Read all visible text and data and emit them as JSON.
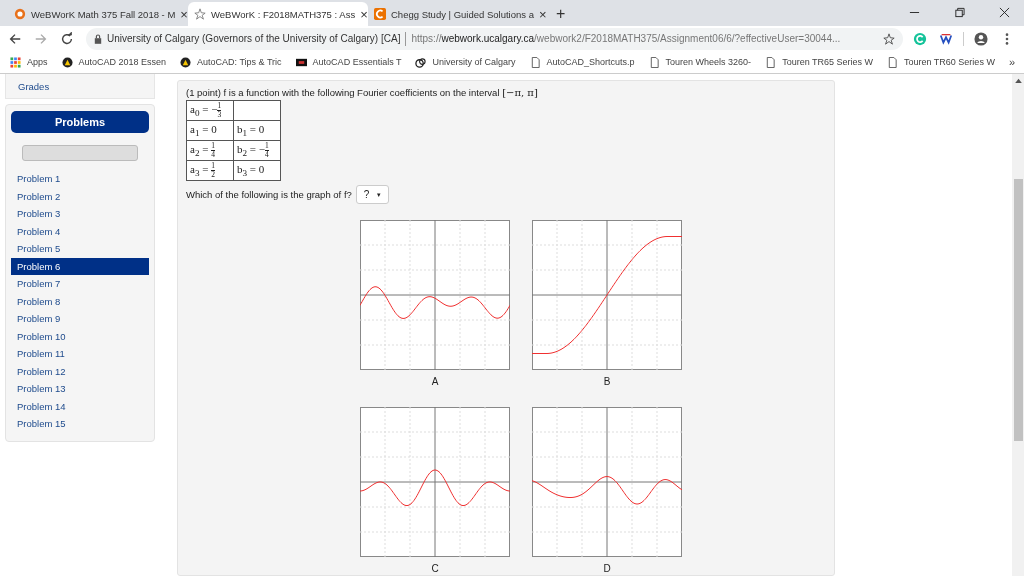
{
  "tabs": [
    {
      "title": "WeBWorK Math 375 Fall 2018 - M",
      "kind": "badge",
      "selected": false,
      "close": "×"
    },
    {
      "title": "WeBWorK : F2018MATH375 : Ass",
      "kind": "star",
      "selected": true,
      "close": "×"
    },
    {
      "title": "Chegg Study | Guided Solutions a",
      "kind": "chegg",
      "selected": false,
      "close": "×"
    }
  ],
  "new_tab": "+",
  "address": {
    "site": "University of Calgary (Governors of the University of Calgary) [CA]",
    "url_scheme": "https://",
    "url_host": "webwork.ucalgary.ca",
    "url_path": "/webwork2/F2018MATH375/Assignment06/6/?effectiveUser=30044..."
  },
  "bookmarks": [
    {
      "label": "Apps",
      "kind": "apps"
    },
    {
      "label": "AutoCAD 2018 Essen",
      "kind": "cad"
    },
    {
      "label": "AutoCAD: Tips & Tric",
      "kind": "cad"
    },
    {
      "label": "AutoCAD Essentials T",
      "kind": "video"
    },
    {
      "label": "University of Calgary",
      "kind": "uc"
    },
    {
      "label": "AutoCAD_Shortcuts.p",
      "kind": "page"
    },
    {
      "label": "Touren Wheels 3260-",
      "kind": "page"
    },
    {
      "label": "Touren TR65 Series W",
      "kind": "page"
    },
    {
      "label": "Touren TR60 Series W",
      "kind": "page"
    }
  ],
  "bookmarks_more": "»",
  "sidebar": {
    "grades": "Grades",
    "header": "Problems",
    "progress": {
      "level": 0
    },
    "items": [
      {
        "label": "Problem 1",
        "selected": false
      },
      {
        "label": "Problem 2",
        "selected": false
      },
      {
        "label": "Problem 3",
        "selected": false
      },
      {
        "label": "Problem 4",
        "selected": false
      },
      {
        "label": "Problem 5",
        "selected": false
      },
      {
        "label": "Problem 6",
        "selected": true
      },
      {
        "label": "Problem 7",
        "selected": false
      },
      {
        "label": "Problem 8",
        "selected": false
      },
      {
        "label": "Problem 9",
        "selected": false
      },
      {
        "label": "Problem 10",
        "selected": false
      },
      {
        "label": "Problem 11",
        "selected": false
      },
      {
        "label": "Problem 12",
        "selected": false
      },
      {
        "label": "Problem 13",
        "selected": false
      },
      {
        "label": "Problem 14",
        "selected": false
      },
      {
        "label": "Problem 15",
        "selected": false
      }
    ]
  },
  "problem": {
    "intro": "(1 point) f is a function with the following Fourier coefficients on the interval ",
    "interval": "[−π, π]",
    "coefficients": [
      [
        {
          "text": "a$_{0}$ = −",
          "frac": [
            "1",
            "3"
          ]
        }
      ],
      [
        {
          "text": "a$_{1}$ = 0"
        },
        {
          "text": "b$_{1}$ = 0"
        }
      ],
      [
        {
          "text": "a$_{2}$ = ",
          "frac": [
            "1",
            "4"
          ]
        },
        {
          "text": "b$_{2}$ = −",
          "frac": [
            "1",
            "4"
          ]
        }
      ],
      [
        {
          "text": "a$_{3}$ = ",
          "frac": [
            "1",
            "2"
          ]
        },
        {
          "text": "b$_{3}$ = 0"
        }
      ]
    ],
    "question": "Which of the following is the graph of f?",
    "answer": "?",
    "caret": "▾",
    "graphs": [
      {
        "label": "A",
        "kind": "ripple"
      },
      {
        "label": "B",
        "kind": "sigmoid"
      },
      {
        "label": "C",
        "kind": "peak"
      },
      {
        "label": "D",
        "kind": "drift"
      }
    ]
  }
}
